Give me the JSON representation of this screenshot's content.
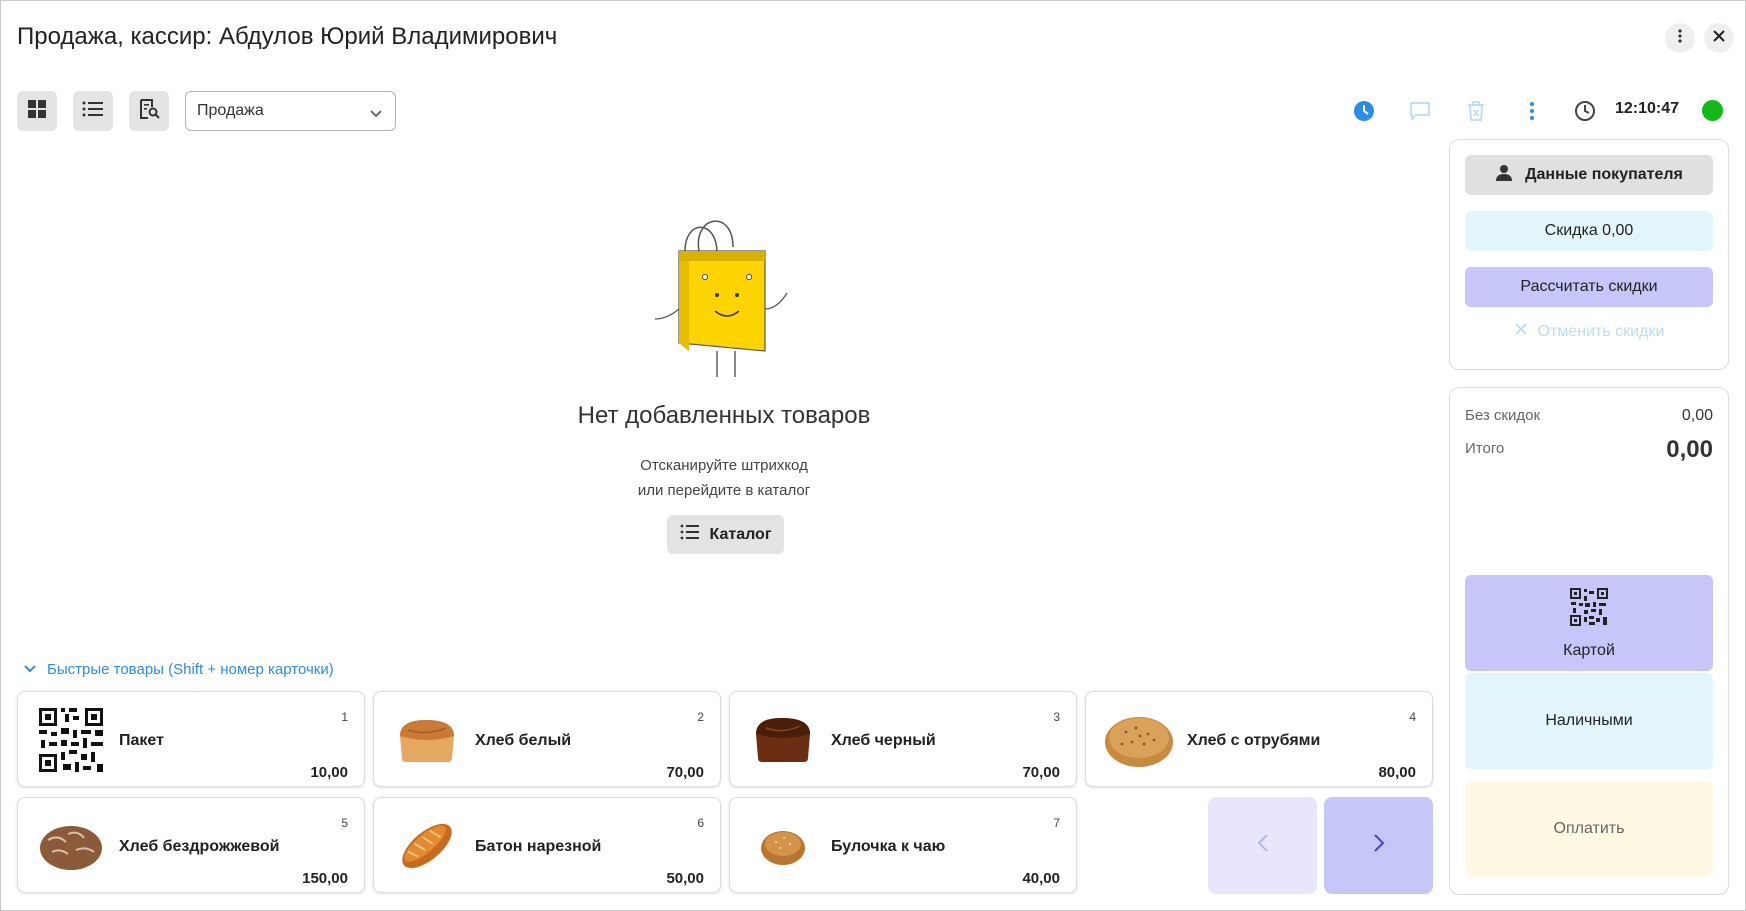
{
  "header": {
    "title": "Продажа, кассир: Абдулов Юрий Владимирович",
    "menu_icon": "vertical-dots-icon",
    "close_icon": "close-icon"
  },
  "toolbar": {
    "view_buttons": [
      "grid-view-icon",
      "list-view-icon",
      "search-document-icon"
    ],
    "mode_select": {
      "value": "Продажа"
    },
    "status_icons": [
      "clock-blue-icon",
      "comment-icon",
      "delete-receipt-icon",
      "more-icon",
      "time-icon"
    ],
    "time": "12:10:47",
    "online_color": "#12b81c"
  },
  "empty_state": {
    "title": "Нет добавленных товаров",
    "line1": "Отсканируйте штрихкод",
    "line2": "или перейдите в каталог",
    "catalog_button": "Каталог"
  },
  "quick_products": {
    "header": "Быстрые товары (Shift + номер карточки)",
    "items": [
      {
        "number": "1",
        "name": "Пакет",
        "price": "10,00",
        "image": "qr-code"
      },
      {
        "number": "2",
        "name": "Хлеб белый",
        "price": "70,00",
        "image": "white-bread"
      },
      {
        "number": "3",
        "name": "Хлеб черный",
        "price": "70,00",
        "image": "black-bread"
      },
      {
        "number": "4",
        "name": "Хлеб с отрубями",
        "price": "80,00",
        "image": "bran-bread"
      },
      {
        "number": "5",
        "name": "Хлеб бездрожжевой",
        "price": "150,00",
        "image": "yeast-free-bread"
      },
      {
        "number": "6",
        "name": "Батон нарезной",
        "price": "50,00",
        "image": "baton"
      },
      {
        "number": "7",
        "name": "Булочка к чаю",
        "price": "40,00",
        "image": "bun"
      }
    ]
  },
  "sidebar": {
    "customer_button": "Данные покупателя",
    "discount_label": "Скидка 0,00",
    "calc_discounts": "Рассчитать скидки",
    "cancel_discounts": "Отменить скидки",
    "no_discount_label": "Без скидок",
    "no_discount_value": "0,00",
    "total_label": "Итого",
    "total_value": "0,00",
    "pay_card": "Картой",
    "pay_cash": "Наличными",
    "pay_button": "Оплатить"
  },
  "colors": {
    "accent_blue": "#2d8ce6",
    "card_pay": "#c7c6f8",
    "cash_pay": "#e2f5fb",
    "pay": "#fff9e3",
    "calc": "#c7c6f8",
    "discount": "#e2f5fb"
  }
}
